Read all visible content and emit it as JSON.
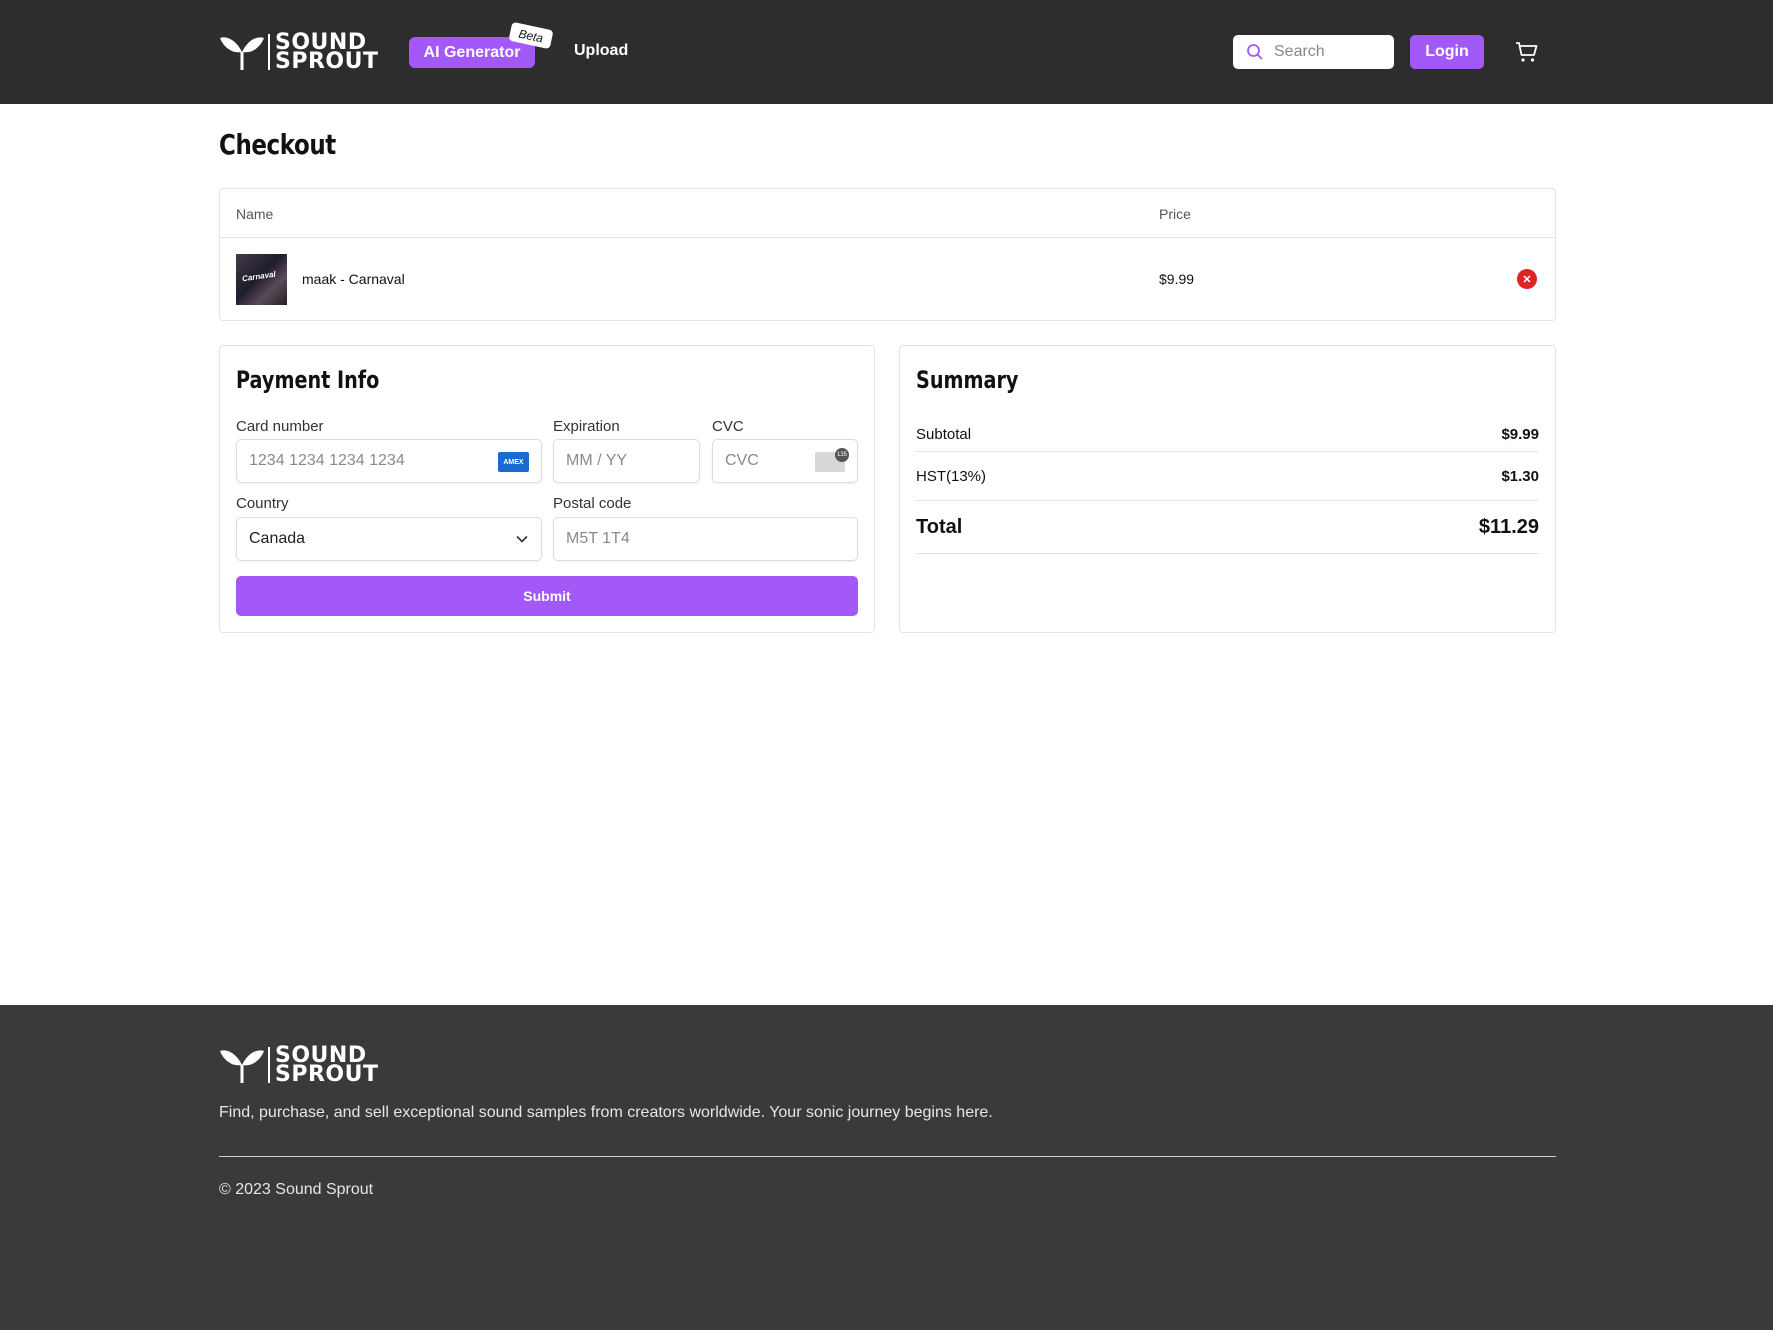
{
  "brand": {
    "line1": "SOUND",
    "line2": "SPROUT"
  },
  "nav": {
    "ai_generator": "AI Generator",
    "beta_badge": "Beta",
    "upload": "Upload",
    "search_placeholder": "Search",
    "login": "Login"
  },
  "page": {
    "title": "Checkout"
  },
  "cart": {
    "columns": {
      "name": "Name",
      "price": "Price"
    },
    "items": [
      {
        "name": "maak - Carnaval",
        "price": "$9.99",
        "thumb_text": "Carnaval"
      }
    ]
  },
  "payment": {
    "title": "Payment Info",
    "card_number": {
      "label": "Card number",
      "placeholder": "1234 1234 1234 1234"
    },
    "expiration": {
      "label": "Expiration",
      "placeholder": "MM / YY"
    },
    "cvc": {
      "label": "CVC",
      "placeholder": "CVC"
    },
    "country": {
      "label": "Country",
      "value": "Canada"
    },
    "postal": {
      "label": "Postal code",
      "placeholder": "M5T 1T4"
    },
    "submit": "Submit"
  },
  "summary": {
    "title": "Summary",
    "subtotal_label": "Subtotal",
    "subtotal_value": "$9.99",
    "tax_label": "HST(13%)",
    "tax_value": "$1.30",
    "total_label": "Total",
    "total_value": "$11.29"
  },
  "footer": {
    "tagline": "Find, purchase, and sell exceptional sound samples from creators worldwide. Your sonic journey begins here.",
    "copyright": "© 2023 Sound Sprout"
  },
  "colors": {
    "accent": "#a259f7",
    "header_bg": "#2d2d2d",
    "footer_bg": "#3a3a3a",
    "remove": "#e02424"
  },
  "icons": [
    "sprout-logo-icon",
    "search-icon",
    "cart-icon",
    "amex-card-icon",
    "cvc-card-icon",
    "chevron-down-icon",
    "close-icon"
  ]
}
